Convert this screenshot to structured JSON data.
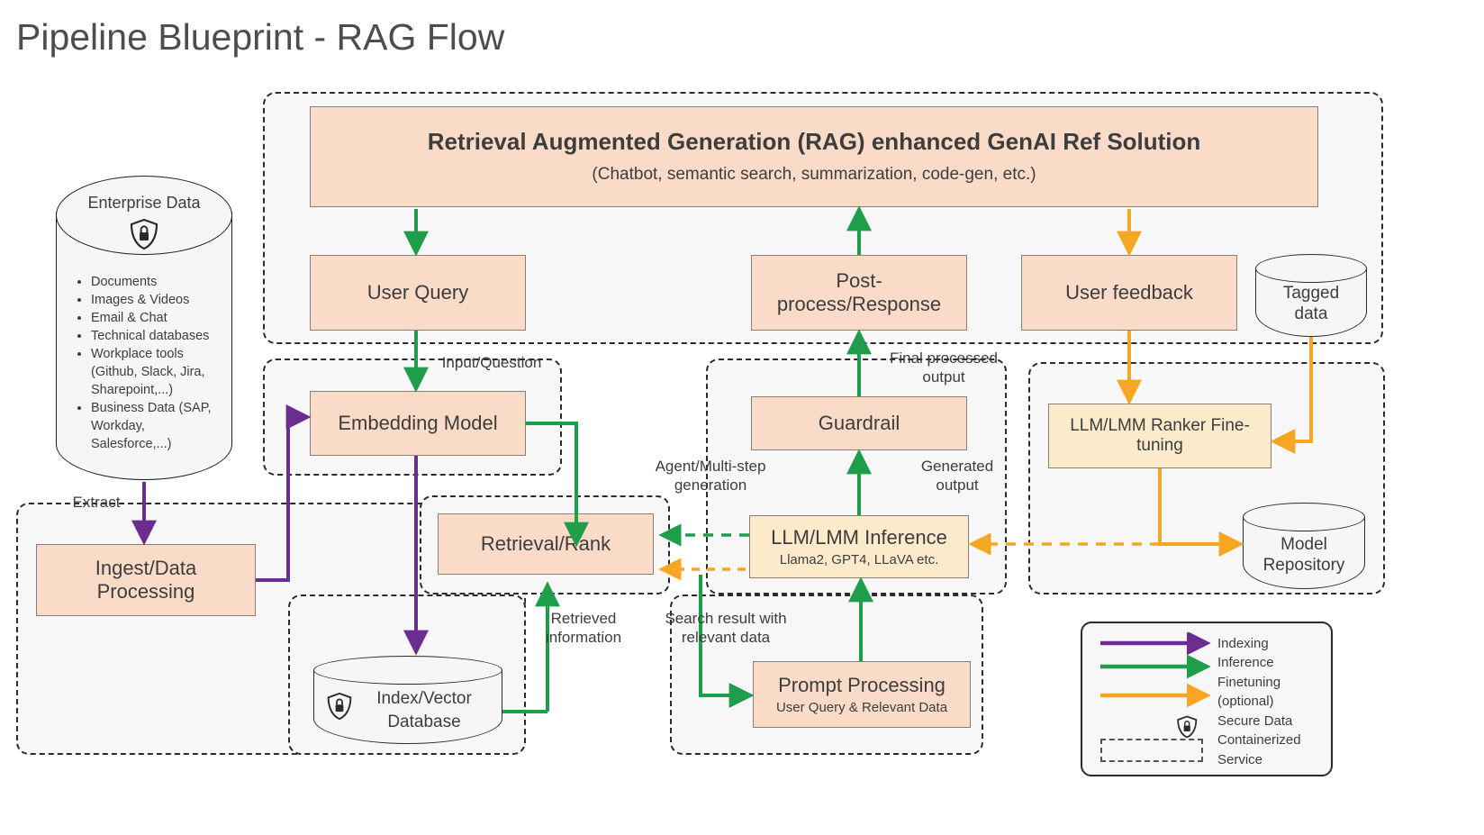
{
  "title": "Pipeline Blueprint - RAG Flow",
  "colors": {
    "indexing": "#6B2D8F",
    "inference": "#1E9E4A",
    "finetuning": "#F5A623",
    "box_fill": "#FADBC8",
    "cream_fill": "#FCEBCB",
    "container_fill": "#F7F7F7",
    "container_border": "#2B2B2B"
  },
  "source": {
    "name": "Enterprise Data",
    "icon": "secure-shield-lock-icon",
    "items": [
      "Documents",
      "Images & Videos",
      "Email & Chat",
      "Technical databases",
      "Workplace tools (Github, Slack, Jira, Sharepoint,...)",
      "Business Data (SAP, Workday, Salesforce,...)"
    ]
  },
  "boxes": {
    "rag_solution": {
      "title": "Retrieval Augmented Generation (RAG) enhanced GenAI Ref Solution",
      "subtitle": "(Chatbot, semantic search, summarization, code-gen, etc.)"
    },
    "user_query": {
      "title": "User Query"
    },
    "post_process": {
      "title": "Post-process/Response",
      "line1": "Post-",
      "line2": "process/Response"
    },
    "user_feedback": {
      "title": "User feedback"
    },
    "embedding_model": {
      "title": "Embedding Model"
    },
    "guardrail": {
      "title": "Guardrail"
    },
    "ranker_finetune": {
      "title": "LLM/LMM Ranker Fine-tuning",
      "line1": "LLM/LMM Ranker Fine-",
      "line2": "tuning"
    },
    "ingest": {
      "title": "Ingest/Data Processing",
      "line1": "Ingest/Data",
      "line2": "Processing"
    },
    "retrieval_rank": {
      "title": "Retrieval/Rank"
    },
    "llm_inference": {
      "title": "LLM/LMM Inference",
      "subtitle": "Llama2, GPT4, LLaVA etc."
    },
    "prompt_processing": {
      "title": "Prompt Processing",
      "subtitle": "User Query & Relevant Data"
    }
  },
  "datastores": {
    "tagged_data": {
      "line1": "Tagged",
      "line2": "data"
    },
    "model_repository": {
      "line1": "Model",
      "line2": "Repository"
    },
    "index_vector_db": {
      "line1": "Index/Vector",
      "line2": "Database",
      "icon": "secure-shield-lock-icon"
    }
  },
  "edge_labels": {
    "extract": "Extract",
    "input_question": "Input/Question",
    "agent_multistep": {
      "line1": "Agent/Multi-step",
      "line2": "generation"
    },
    "final_processed": {
      "line1": "Final processed",
      "line2": "output"
    },
    "generated_output": {
      "line1": "Generated",
      "line2": "output"
    },
    "retrieved_information": {
      "line1": "Retrieved",
      "line2": "information"
    },
    "search_result": {
      "line1": "Search result with",
      "line2": "relevant data"
    }
  },
  "legend": {
    "items": [
      {
        "label": "Indexing",
        "glyph": "arrow-purple"
      },
      {
        "label": "Inference",
        "glyph": "arrow-green"
      },
      {
        "label": "Finetuning",
        "glyph": "arrow-orange"
      },
      {
        "label": "(optional)",
        "glyph": "none"
      },
      {
        "label": "Secure Data",
        "glyph": "shield-lock-icon"
      },
      {
        "label": "Containerized",
        "glyph": "none"
      },
      {
        "label": "Service",
        "glyph": "dashed-box"
      }
    ],
    "text_block": "Indexing\nInference\nFinetuning\n(optional)\nSecure Data\nContainerized\nService"
  }
}
